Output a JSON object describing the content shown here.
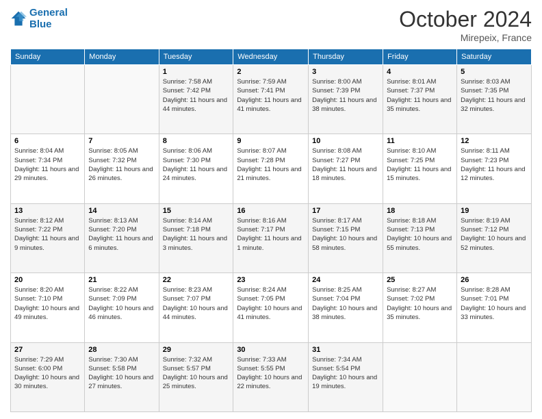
{
  "header": {
    "logo_line1": "General",
    "logo_line2": "Blue",
    "month": "October 2024",
    "location": "Mirepeix, France"
  },
  "weekdays": [
    "Sunday",
    "Monday",
    "Tuesday",
    "Wednesday",
    "Thursday",
    "Friday",
    "Saturday"
  ],
  "weeks": [
    [
      {
        "num": "",
        "sunrise": "",
        "sunset": "",
        "daylight": ""
      },
      {
        "num": "",
        "sunrise": "",
        "sunset": "",
        "daylight": ""
      },
      {
        "num": "1",
        "sunrise": "Sunrise: 7:58 AM",
        "sunset": "Sunset: 7:42 PM",
        "daylight": "Daylight: 11 hours and 44 minutes."
      },
      {
        "num": "2",
        "sunrise": "Sunrise: 7:59 AM",
        "sunset": "Sunset: 7:41 PM",
        "daylight": "Daylight: 11 hours and 41 minutes."
      },
      {
        "num": "3",
        "sunrise": "Sunrise: 8:00 AM",
        "sunset": "Sunset: 7:39 PM",
        "daylight": "Daylight: 11 hours and 38 minutes."
      },
      {
        "num": "4",
        "sunrise": "Sunrise: 8:01 AM",
        "sunset": "Sunset: 7:37 PM",
        "daylight": "Daylight: 11 hours and 35 minutes."
      },
      {
        "num": "5",
        "sunrise": "Sunrise: 8:03 AM",
        "sunset": "Sunset: 7:35 PM",
        "daylight": "Daylight: 11 hours and 32 minutes."
      }
    ],
    [
      {
        "num": "6",
        "sunrise": "Sunrise: 8:04 AM",
        "sunset": "Sunset: 7:34 PM",
        "daylight": "Daylight: 11 hours and 29 minutes."
      },
      {
        "num": "7",
        "sunrise": "Sunrise: 8:05 AM",
        "sunset": "Sunset: 7:32 PM",
        "daylight": "Daylight: 11 hours and 26 minutes."
      },
      {
        "num": "8",
        "sunrise": "Sunrise: 8:06 AM",
        "sunset": "Sunset: 7:30 PM",
        "daylight": "Daylight: 11 hours and 24 minutes."
      },
      {
        "num": "9",
        "sunrise": "Sunrise: 8:07 AM",
        "sunset": "Sunset: 7:28 PM",
        "daylight": "Daylight: 11 hours and 21 minutes."
      },
      {
        "num": "10",
        "sunrise": "Sunrise: 8:08 AM",
        "sunset": "Sunset: 7:27 PM",
        "daylight": "Daylight: 11 hours and 18 minutes."
      },
      {
        "num": "11",
        "sunrise": "Sunrise: 8:10 AM",
        "sunset": "Sunset: 7:25 PM",
        "daylight": "Daylight: 11 hours and 15 minutes."
      },
      {
        "num": "12",
        "sunrise": "Sunrise: 8:11 AM",
        "sunset": "Sunset: 7:23 PM",
        "daylight": "Daylight: 11 hours and 12 minutes."
      }
    ],
    [
      {
        "num": "13",
        "sunrise": "Sunrise: 8:12 AM",
        "sunset": "Sunset: 7:22 PM",
        "daylight": "Daylight: 11 hours and 9 minutes."
      },
      {
        "num": "14",
        "sunrise": "Sunrise: 8:13 AM",
        "sunset": "Sunset: 7:20 PM",
        "daylight": "Daylight: 11 hours and 6 minutes."
      },
      {
        "num": "15",
        "sunrise": "Sunrise: 8:14 AM",
        "sunset": "Sunset: 7:18 PM",
        "daylight": "Daylight: 11 hours and 3 minutes."
      },
      {
        "num": "16",
        "sunrise": "Sunrise: 8:16 AM",
        "sunset": "Sunset: 7:17 PM",
        "daylight": "Daylight: 11 hours and 1 minute."
      },
      {
        "num": "17",
        "sunrise": "Sunrise: 8:17 AM",
        "sunset": "Sunset: 7:15 PM",
        "daylight": "Daylight: 10 hours and 58 minutes."
      },
      {
        "num": "18",
        "sunrise": "Sunrise: 8:18 AM",
        "sunset": "Sunset: 7:13 PM",
        "daylight": "Daylight: 10 hours and 55 minutes."
      },
      {
        "num": "19",
        "sunrise": "Sunrise: 8:19 AM",
        "sunset": "Sunset: 7:12 PM",
        "daylight": "Daylight: 10 hours and 52 minutes."
      }
    ],
    [
      {
        "num": "20",
        "sunrise": "Sunrise: 8:20 AM",
        "sunset": "Sunset: 7:10 PM",
        "daylight": "Daylight: 10 hours and 49 minutes."
      },
      {
        "num": "21",
        "sunrise": "Sunrise: 8:22 AM",
        "sunset": "Sunset: 7:09 PM",
        "daylight": "Daylight: 10 hours and 46 minutes."
      },
      {
        "num": "22",
        "sunrise": "Sunrise: 8:23 AM",
        "sunset": "Sunset: 7:07 PM",
        "daylight": "Daylight: 10 hours and 44 minutes."
      },
      {
        "num": "23",
        "sunrise": "Sunrise: 8:24 AM",
        "sunset": "Sunset: 7:05 PM",
        "daylight": "Daylight: 10 hours and 41 minutes."
      },
      {
        "num": "24",
        "sunrise": "Sunrise: 8:25 AM",
        "sunset": "Sunset: 7:04 PM",
        "daylight": "Daylight: 10 hours and 38 minutes."
      },
      {
        "num": "25",
        "sunrise": "Sunrise: 8:27 AM",
        "sunset": "Sunset: 7:02 PM",
        "daylight": "Daylight: 10 hours and 35 minutes."
      },
      {
        "num": "26",
        "sunrise": "Sunrise: 8:28 AM",
        "sunset": "Sunset: 7:01 PM",
        "daylight": "Daylight: 10 hours and 33 minutes."
      }
    ],
    [
      {
        "num": "27",
        "sunrise": "Sunrise: 7:29 AM",
        "sunset": "Sunset: 6:00 PM",
        "daylight": "Daylight: 10 hours and 30 minutes."
      },
      {
        "num": "28",
        "sunrise": "Sunrise: 7:30 AM",
        "sunset": "Sunset: 5:58 PM",
        "daylight": "Daylight: 10 hours and 27 minutes."
      },
      {
        "num": "29",
        "sunrise": "Sunrise: 7:32 AM",
        "sunset": "Sunset: 5:57 PM",
        "daylight": "Daylight: 10 hours and 25 minutes."
      },
      {
        "num": "30",
        "sunrise": "Sunrise: 7:33 AM",
        "sunset": "Sunset: 5:55 PM",
        "daylight": "Daylight: 10 hours and 22 minutes."
      },
      {
        "num": "31",
        "sunrise": "Sunrise: 7:34 AM",
        "sunset": "Sunset: 5:54 PM",
        "daylight": "Daylight: 10 hours and 19 minutes."
      },
      {
        "num": "",
        "sunrise": "",
        "sunset": "",
        "daylight": ""
      },
      {
        "num": "",
        "sunrise": "",
        "sunset": "",
        "daylight": ""
      }
    ]
  ]
}
